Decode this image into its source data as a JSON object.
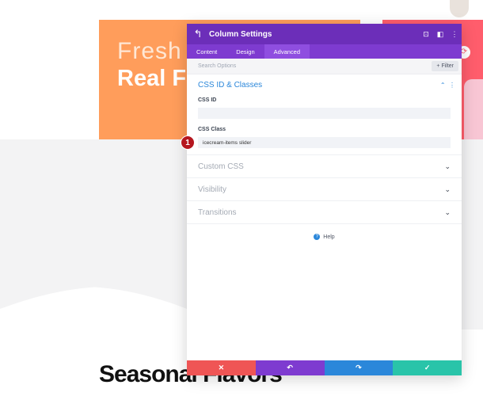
{
  "background": {
    "hero_line1": "Fresh I",
    "hero_line2": "Real Fl",
    "seasonal_heading": "Seasonal Flavors"
  },
  "modal": {
    "title": "Column Settings",
    "tabs": [
      {
        "label": "Content",
        "active": false
      },
      {
        "label": "Design",
        "active": false
      },
      {
        "label": "Advanced",
        "active": true
      }
    ],
    "search_placeholder": "Search Options",
    "filter_label": "+ Filter",
    "open_section": {
      "title": "CSS ID & Classes",
      "css_id_label": "CSS ID",
      "css_id_value": "",
      "css_class_label": "CSS Class",
      "css_class_value": "icecream-items slider",
      "step_badge": "1"
    },
    "collapsed_sections": [
      "Custom CSS",
      "Visibility",
      "Transitions"
    ],
    "help_label": "Help",
    "footer_buttons": [
      {
        "name": "discard",
        "icon": "✕",
        "color": "#ef5555"
      },
      {
        "name": "undo",
        "icon": "↶",
        "color": "#7e3bd0"
      },
      {
        "name": "redo",
        "icon": "↷",
        "color": "#2b87da"
      },
      {
        "name": "save",
        "icon": "✓",
        "color": "#29c4a9"
      }
    ]
  },
  "colors": {
    "header": "#6c2eb9",
    "tabs": "#7e3bd0",
    "accent": "#2b87da"
  }
}
